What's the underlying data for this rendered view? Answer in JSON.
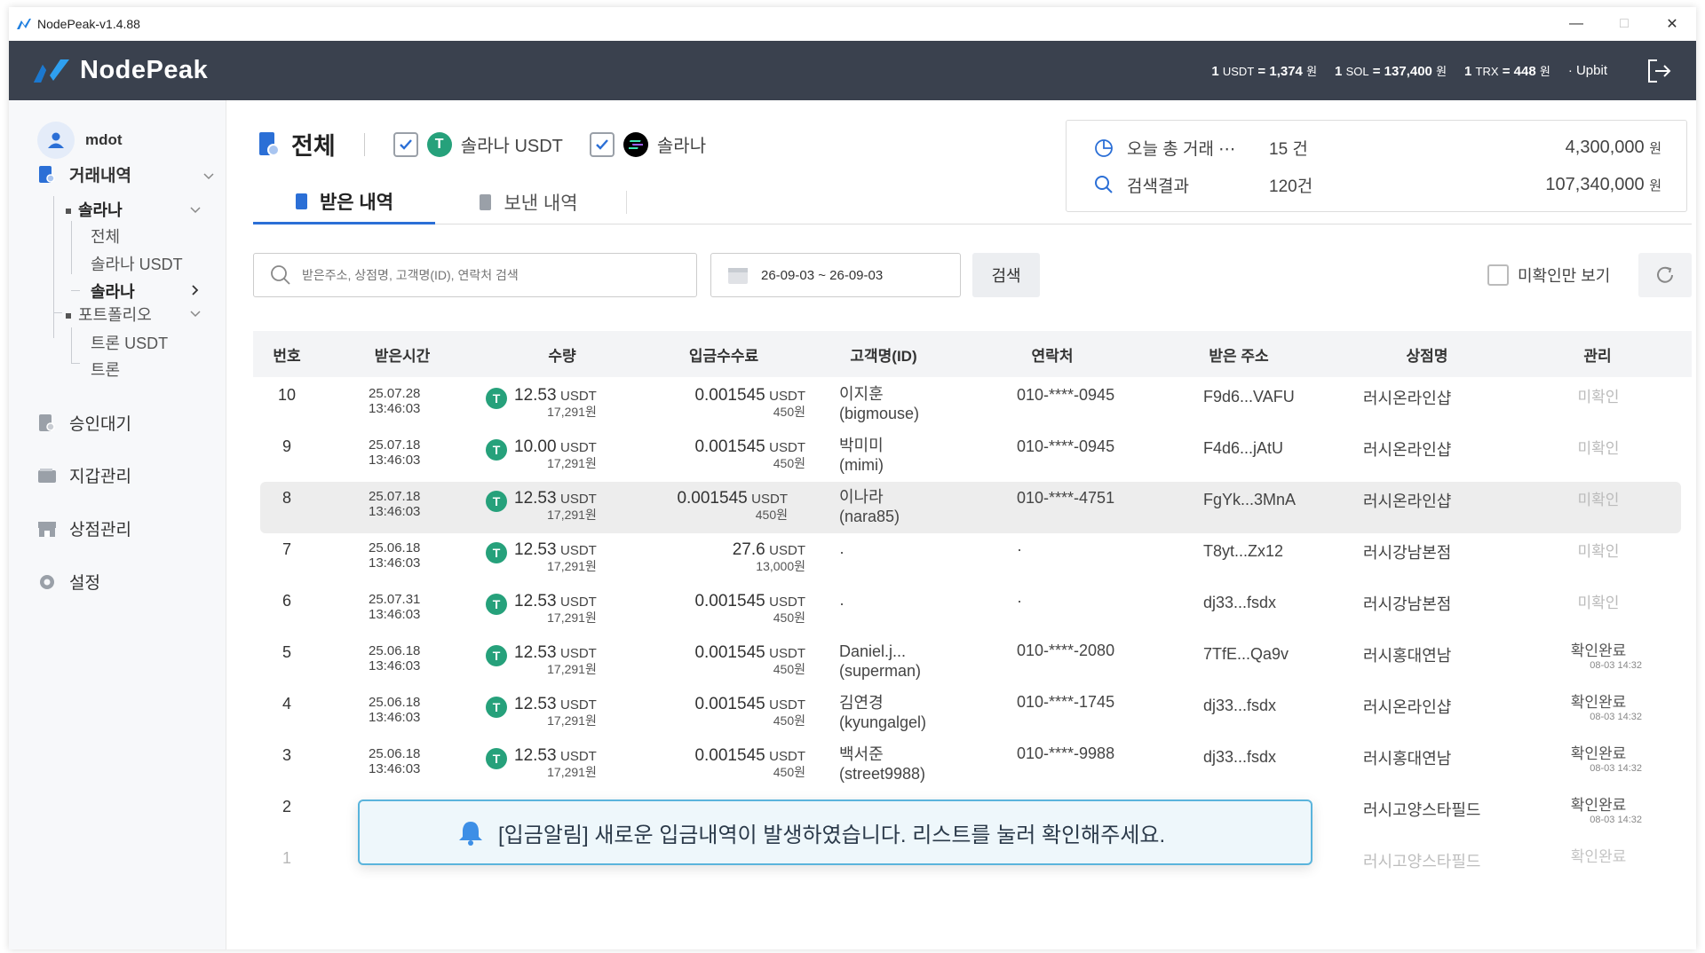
{
  "window": {
    "title": "NodePeak-v1.4.88"
  },
  "header": {
    "brand": "NodePeak",
    "rates": [
      {
        "left": "1 ",
        "unit": "USDT",
        "eq": " = 1,374 ",
        "won": "원"
      },
      {
        "left": "1 ",
        "unit": "SOL",
        "eq": " = 137,400 ",
        "won": "원"
      },
      {
        "left": "1 ",
        "unit": "TRX",
        "eq": " = 448 ",
        "won": "원"
      }
    ],
    "exchange": "· Upbit"
  },
  "sidebar": {
    "user": "mdot",
    "menu": {
      "transactions": "거래내역",
      "solana": "솔라나",
      "all": "전체",
      "solana_usdt": "솔라나 USDT",
      "solana_selected": "솔라나",
      "portfolio": "포트폴리오",
      "tron_usdt": "트론 USDT",
      "tron": "트론",
      "pending": "승인대기",
      "wallet": "지갑관리",
      "store": "상점관리",
      "settings": "설정"
    }
  },
  "filters": {
    "title": "전체",
    "opt1": "솔라나 USDT",
    "opt2": "솔라나"
  },
  "tabs": {
    "received": "받은 내역",
    "sent": "보낸 내역"
  },
  "summary": {
    "today_label": "오늘 총 거래",
    "today_count": "15 건",
    "today_amount": "4,300,000",
    "search_label": "검색결과",
    "search_count": "120건",
    "search_amount": "107,340,000",
    "won": "원"
  },
  "search": {
    "placeholder": "받은주소, 상점명, 고객명(ID), 연락처 검색",
    "date_range": "26-09-03 ~ 26-09-03",
    "button": "검색",
    "unconfirmed_only": "미확인만 보기"
  },
  "table": {
    "headers": {
      "num": "번호",
      "time": "받은시간",
      "amount": "수량",
      "fee": "입금수수료",
      "customer": "고객명(ID)",
      "phone": "연락처",
      "address": "받은 주소",
      "store": "상점명",
      "manage": "관리"
    },
    "rows": [
      {
        "num": "10",
        "date": "25.07.28",
        "time": "13:46:03",
        "amt": "12.53",
        "amt_unit": "USDT",
        "amt_won": "17,291원",
        "fee": "0.001545",
        "fee_unit": "USDT",
        "fee_won": "450원",
        "cust1": "이지훈",
        "cust2": "(bigmouse)",
        "phone": "010-****-0945",
        "addr": "F9d6...VAFU",
        "store": "러시온라인샵",
        "status": "미확인",
        "status_dt": ""
      },
      {
        "num": "9",
        "date": "25.07.18",
        "time": "13:46:03",
        "amt": "10.00",
        "amt_unit": "USDT",
        "amt_won": "17,291원",
        "fee": "0.001545",
        "fee_unit": "USDT",
        "fee_won": "450원",
        "cust1": "박미미",
        "cust2": "(mimi)",
        "phone": "010-****-0945",
        "addr": "F4d6...jAtU",
        "store": "러시온라인샵",
        "status": "미확인",
        "status_dt": ""
      },
      {
        "num": "8",
        "date": "25.07.18",
        "time": "13:46:03",
        "amt": "12.53",
        "amt_unit": "USDT",
        "amt_won": "17,291원",
        "fee": "0.001545",
        "fee_unit": "USDT",
        "fee_won": "450원",
        "cust1": "이나라",
        "cust2": "(nara85)",
        "phone": "010-****-4751",
        "addr": "FgYk...3MnA",
        "store": "러시온라인샵",
        "status": "미확인",
        "status_dt": ""
      },
      {
        "num": "7",
        "date": "25.06.18",
        "time": "13:46:03",
        "amt": "12.53",
        "amt_unit": "USDT",
        "amt_won": "17,291원",
        "fee": "27.6",
        "fee_unit": "USDT",
        "fee_won": "13,000원",
        "cust1": "·",
        "cust2": "",
        "phone": "·",
        "addr": "T8yt...Zx12",
        "store": "러시강남본점",
        "status": "미확인",
        "status_dt": ""
      },
      {
        "num": "6",
        "date": "25.07.31",
        "time": "13:46:03",
        "amt": "12.53",
        "amt_unit": "USDT",
        "amt_won": "17,291원",
        "fee": "0.001545",
        "fee_unit": "USDT",
        "fee_won": "450원",
        "cust1": "·",
        "cust2": "",
        "phone": "·",
        "addr": "dj33...fsdx",
        "store": "러시강남본점",
        "status": "미확인",
        "status_dt": ""
      },
      {
        "num": "5",
        "date": "25.06.18",
        "time": "13:46:03",
        "amt": "12.53",
        "amt_unit": "USDT",
        "amt_won": "17,291원",
        "fee": "0.001545",
        "fee_unit": "USDT",
        "fee_won": "450원",
        "cust1": "Daniel.j...",
        "cust2": "(superman)",
        "phone": "010-****-2080",
        "addr": "7TfE...Qa9v",
        "store": "러시홍대연남",
        "status": "확인완료",
        "status_dt": "08-03 14:32"
      },
      {
        "num": "4",
        "date": "25.06.18",
        "time": "13:46:03",
        "amt": "12.53",
        "amt_unit": "USDT",
        "amt_won": "17,291원",
        "fee": "0.001545",
        "fee_unit": "USDT",
        "fee_won": "450원",
        "cust1": "김연경",
        "cust2": "(kyungalgel)",
        "phone": "010-****-1745",
        "addr": "dj33...fsdx",
        "store": "러시온라인샵",
        "status": "확인완료",
        "status_dt": "08-03 14:32"
      },
      {
        "num": "3",
        "date": "25.06.18",
        "time": "13:46:03",
        "amt": "12.53",
        "amt_unit": "USDT",
        "amt_won": "17,291원",
        "fee": "0.001545",
        "fee_unit": "USDT",
        "fee_won": "450원",
        "cust1": "백서준",
        "cust2": "(street9988)",
        "phone": "010-****-9988",
        "addr": "dj33...fsdx",
        "store": "러시홍대연남",
        "status": "확인완료",
        "status_dt": "08-03 14:32"
      }
    ],
    "row2": {
      "num": "2",
      "store": "러시고양스타필드",
      "status": "확인완료",
      "status_dt": "08-03 14:32"
    },
    "row1": {
      "num": "1",
      "store": "러시고양스타필드",
      "status": "확인완료"
    }
  },
  "toast": {
    "message": "[입금알림] 새로운 입금내역이 발생하였습니다. 리스트를 눌러 확인해주세요."
  }
}
